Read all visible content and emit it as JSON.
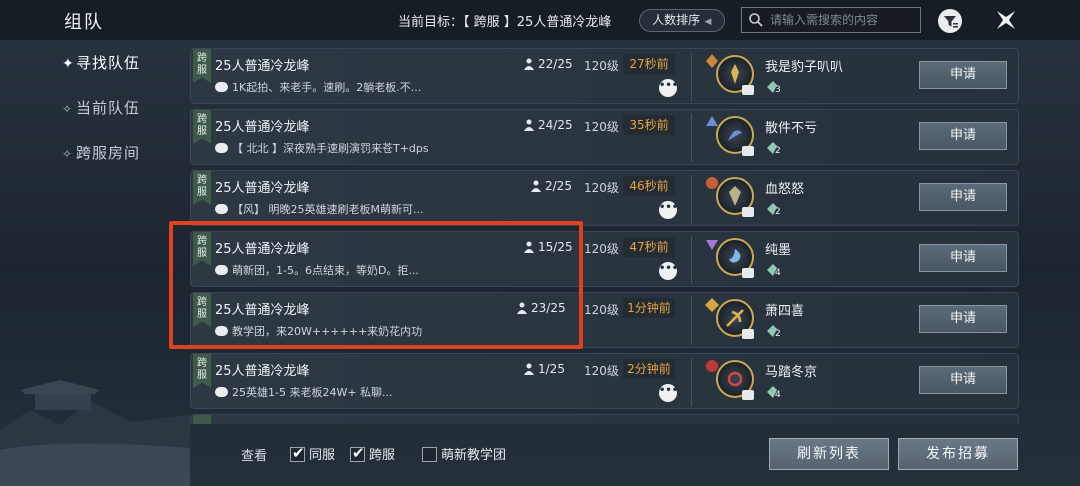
{
  "app_title": "组队",
  "header": {
    "target_prefix": "当前目标：",
    "target_value": "【 跨服 】25人普通冷龙峰",
    "sort_label": "人数排序",
    "search_placeholder": "请输入需搜索的内容"
  },
  "sidebar": {
    "items": [
      {
        "label": "寻找队伍",
        "active": true
      },
      {
        "label": "当前队伍",
        "active": false
      },
      {
        "label": "跨服房间",
        "active": false
      }
    ]
  },
  "rows": [
    {
      "tag": "跨服",
      "title": "25人普通冷龙峰",
      "desc": "1K起拍、来老手。速刷。2躺老板.不...",
      "members": "22/25",
      "level": "120级",
      "time": "27秒前",
      "leader": "我是豹子叭叭",
      "guild_num": "3"
    },
    {
      "tag": "跨服",
      "title": "25人普通冷龙峰",
      "desc": "【 北北 】深夜熟手速刷演罚来苍T+dps",
      "members": "24/25",
      "level": "120级",
      "time": "35秒前",
      "leader": "散件不亏",
      "guild_num": "2"
    },
    {
      "tag": "跨服",
      "title": "25人普通冷龙峰",
      "desc": "【风】 明晚25英雄速刷老板M萌新可...",
      "members": "2/25",
      "level": "120级",
      "time": "46秒前",
      "leader": "血怒怒",
      "guild_num": "2"
    },
    {
      "tag": "跨服",
      "title": "25人普通冷龙峰",
      "desc": "萌新团，1-5。6点结束，等奶D。拒...",
      "members": "15/25",
      "level": "120级",
      "time": "47秒前",
      "leader": "纯墨",
      "guild_num": "4"
    },
    {
      "tag": "跨服",
      "title": "25人普通冷龙峰",
      "desc": "教学团，来20W++++++来奶花内功",
      "members": "23/25",
      "level": "120级",
      "time": "1分钟前",
      "leader": "萧四喜",
      "guild_num": "2"
    },
    {
      "tag": "跨服",
      "title": "25人普通冷龙峰",
      "desc": "25英雄1-5 来老板24W+ 私聊...",
      "members": "1/25",
      "level": "120级",
      "time": "2分钟前",
      "leader": "马踏冬京",
      "guild_num": "4"
    }
  ],
  "apply_label": "申请",
  "bottom": {
    "view_label": "查看",
    "filters": [
      {
        "label": "同服",
        "checked": true
      },
      {
        "label": "跨服",
        "checked": true
      },
      {
        "label": "萌新教学团",
        "checked": false
      }
    ],
    "refresh_label": "刷新列表",
    "publish_label": "发布招募"
  },
  "colors": {
    "time_orange": "#e7a441",
    "highlight": "#e0401f",
    "server_tag": "#3f5a4d"
  }
}
